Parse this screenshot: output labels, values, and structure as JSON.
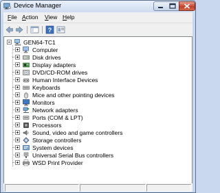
{
  "window": {
    "title": "Device Manager"
  },
  "menu": [
    {
      "label": "File",
      "accel": "F",
      "rest": "ile"
    },
    {
      "label": "Action",
      "accel": "A",
      "rest": "ction"
    },
    {
      "label": "View",
      "accel": "V",
      "rest": "iew"
    },
    {
      "label": "Help",
      "accel": "H",
      "rest": "elp"
    }
  ],
  "toolbar": {
    "buttons": [
      "back-icon",
      "forward-icon",
      "show-hide-console-tree-icon",
      "help-icon",
      "properties-icon"
    ]
  },
  "tree": {
    "root": "GEN64-TC1",
    "items": [
      {
        "label": "Computer",
        "icon": "computer-icon"
      },
      {
        "label": "Disk drives",
        "icon": "disk-drive-icon"
      },
      {
        "label": "Display adapters",
        "icon": "display-adapter-icon"
      },
      {
        "label": "DVD/CD-ROM drives",
        "icon": "dvd-drive-icon"
      },
      {
        "label": "Human Interface Devices",
        "icon": "hid-icon"
      },
      {
        "label": "Keyboards",
        "icon": "keyboard-icon"
      },
      {
        "label": "Mice and other pointing devices",
        "icon": "mouse-icon"
      },
      {
        "label": "Monitors",
        "icon": "monitor-icon"
      },
      {
        "label": "Network adapters",
        "icon": "network-adapter-icon"
      },
      {
        "label": "Ports (COM & LPT)",
        "icon": "port-icon"
      },
      {
        "label": "Processors",
        "icon": "processor-icon"
      },
      {
        "label": "Sound, video and game controllers",
        "icon": "sound-icon"
      },
      {
        "label": "Storage controllers",
        "icon": "storage-controller-icon"
      },
      {
        "label": "System devices",
        "icon": "system-device-icon"
      },
      {
        "label": "Universal Serial Bus controllers",
        "icon": "usb-icon"
      },
      {
        "label": "WSD Print Provider",
        "icon": "printer-icon"
      }
    ]
  }
}
